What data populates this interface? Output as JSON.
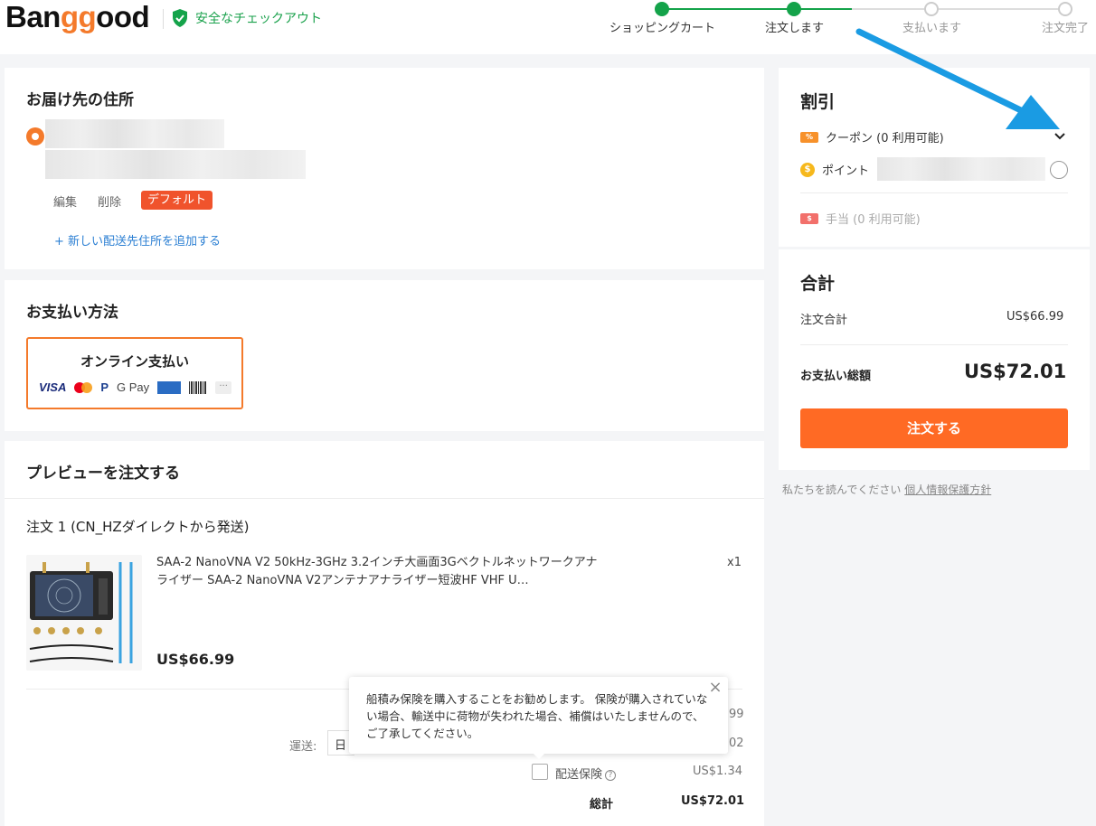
{
  "header": {
    "logo_prefix": "Ban",
    "logo_highlight": "gg",
    "logo_suffix": "ood",
    "secure_label": "安全なチェックアウト"
  },
  "steps": [
    {
      "label": "ショッピングカート",
      "state": "done"
    },
    {
      "label": "注文します",
      "state": "done"
    },
    {
      "label": "支払います",
      "state": "pending"
    },
    {
      "label": "注文完了",
      "state": "pending"
    }
  ],
  "address": {
    "title": "お届け先の住所",
    "edit_label": "編集",
    "delete_label": "削除",
    "default_badge": "デフォルト",
    "add_new_label": "+ 新しい配送先住所を追加する"
  },
  "payment": {
    "title": "お支払い方法",
    "option_label": "オンライン支払い",
    "icons": {
      "visa": "VISA",
      "paypal": "P",
      "gpay": "G Pay",
      "more": "···"
    }
  },
  "preview": {
    "title": "プレビューを注文する",
    "order_label": "注文 1 (CN_HZダイレクトから発送)",
    "product": {
      "title": "SAA-2 NanoVNA V2 50kHz-3GHz 3.2インチ大画面3Gベクトルネットワークアナライザー SAA-2 NanoVNA V2アンテナアナライザー短波HF VHF U…",
      "quantity": "x1",
      "price": "US$66.99"
    },
    "partial_subtotal": "99",
    "shipping_label": "運送:",
    "shipping_value_partial": "日",
    "shipping_price_partial": "02",
    "insurance_label": "配送保険",
    "insurance_price": "US$1.34",
    "total_label": "総計",
    "total_value": "US$72.01"
  },
  "tooltip": {
    "text": "船積み保険を購入することをお勧めします。 保険が購入されていない場合、輸送中に荷物が失われた場合、補償はいたしませんので、ご了承してください。",
    "close": "×"
  },
  "discount": {
    "title": "割引",
    "coupon_icon": "%",
    "coupon_label": "クーポン (0 利用可能)",
    "points_icon": "$",
    "points_label": "ポイント",
    "allowance_icon": "$",
    "allowance_label": "手当 (0 利用可能)"
  },
  "summary": {
    "title": "合計",
    "order_total_label": "注文合計",
    "order_total_value": "US$66.99",
    "grand_total_label": "お支払い総額",
    "grand_total_value": "US$72.01",
    "order_button": "注文する"
  },
  "privacy": {
    "prefix": "私たちを読んでください",
    "link": "個人情報保護方針"
  },
  "colors": {
    "brand_orange": "#f47a2b",
    "button_orange": "#ff6a24",
    "success_green": "#14a34a",
    "link_blue": "#2b7fd3",
    "annotation_arrow": "#1a9be3"
  }
}
